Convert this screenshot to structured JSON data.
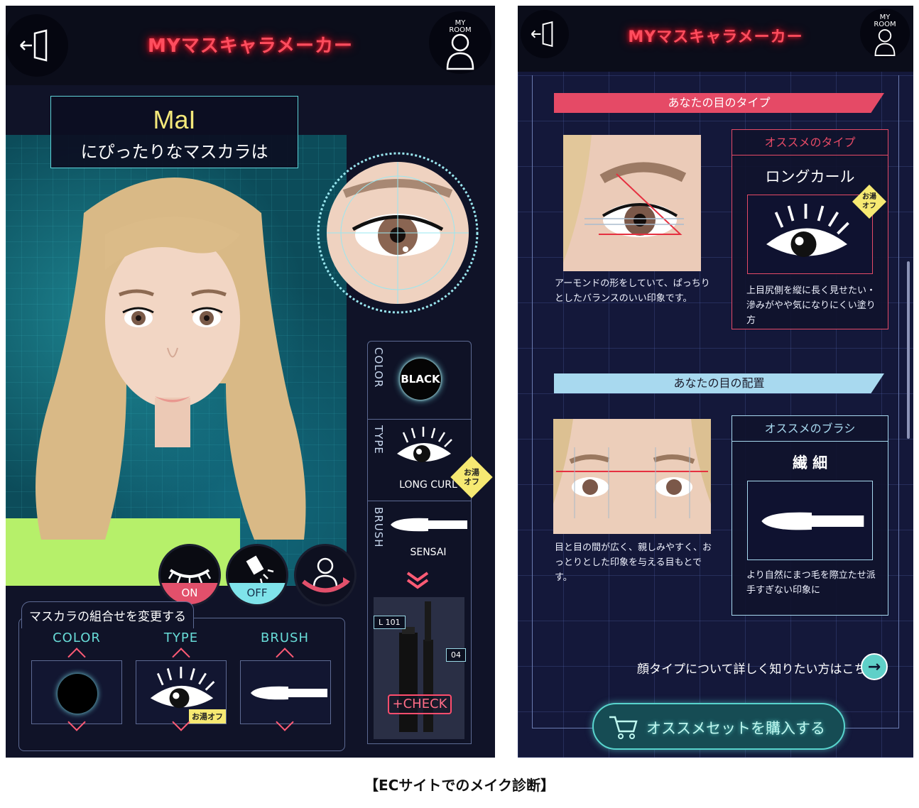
{
  "left_screen": {
    "title": "MYマスキャラメーカー",
    "myroom_label": "MY\nROOM",
    "user_name": "MaI",
    "subtitle": "にぴったりなマスカラは",
    "side_panel": {
      "color_label": "COLOR",
      "color_value": "BLACK",
      "type_label": "TYPE",
      "type_value": "LONG CURL",
      "type_badge": "お湯\nオフ",
      "brush_label": "BRUSH",
      "brush_value": "SENSAI",
      "product_tag_left": "L 101",
      "product_tag_right": "04",
      "check_label": "+CHECK"
    },
    "toggles": {
      "lashes": "ON",
      "light": "OFF"
    },
    "combo": {
      "title": "マスカラの組合せを変更する",
      "color": "COLOR",
      "type": "TYPE",
      "brush": "BRUSH",
      "type_badge": "お湯オフ"
    }
  },
  "right_screen": {
    "title": "MYマスキャラメーカー",
    "myroom_label": "MY\nROOM",
    "eye_type": {
      "banner": "あなたの目のタイプ",
      "description": "アーモンドの形をしていて、ぱっちりとしたバランスのいい印象です。",
      "rec_heading": "オススメのタイプ",
      "rec_name": "ロングカール",
      "rec_badge": "お湯\nオフ",
      "rec_description": "上目尻側を縦に長く見せたい・滲みがやや気になりにくい塗り方"
    },
    "eye_placement": {
      "banner": "あなたの目の配置",
      "description": "目と目の間が広く、親しみやすく、おっとりとした印象を与える目もとです。",
      "rec_heading": "オススメのブラシ",
      "rec_name": "繊 細",
      "rec_description": "より自然にまつ毛を際立たせ派手すぎない印象に"
    },
    "link_text": "顔タイプについて詳しく知りたい方はこちら",
    "link_arrow": "→",
    "buy_button": "オススメセットを購入する"
  },
  "caption": "【ECサイトでのメイク診断】",
  "colors": {
    "title_red": "#ff4d5e",
    "accent_teal": "#5fd3d8",
    "banner_pink": "#e54a66",
    "banner_blue": "#a8d9ef",
    "badge_yellow": "#f6e972"
  }
}
